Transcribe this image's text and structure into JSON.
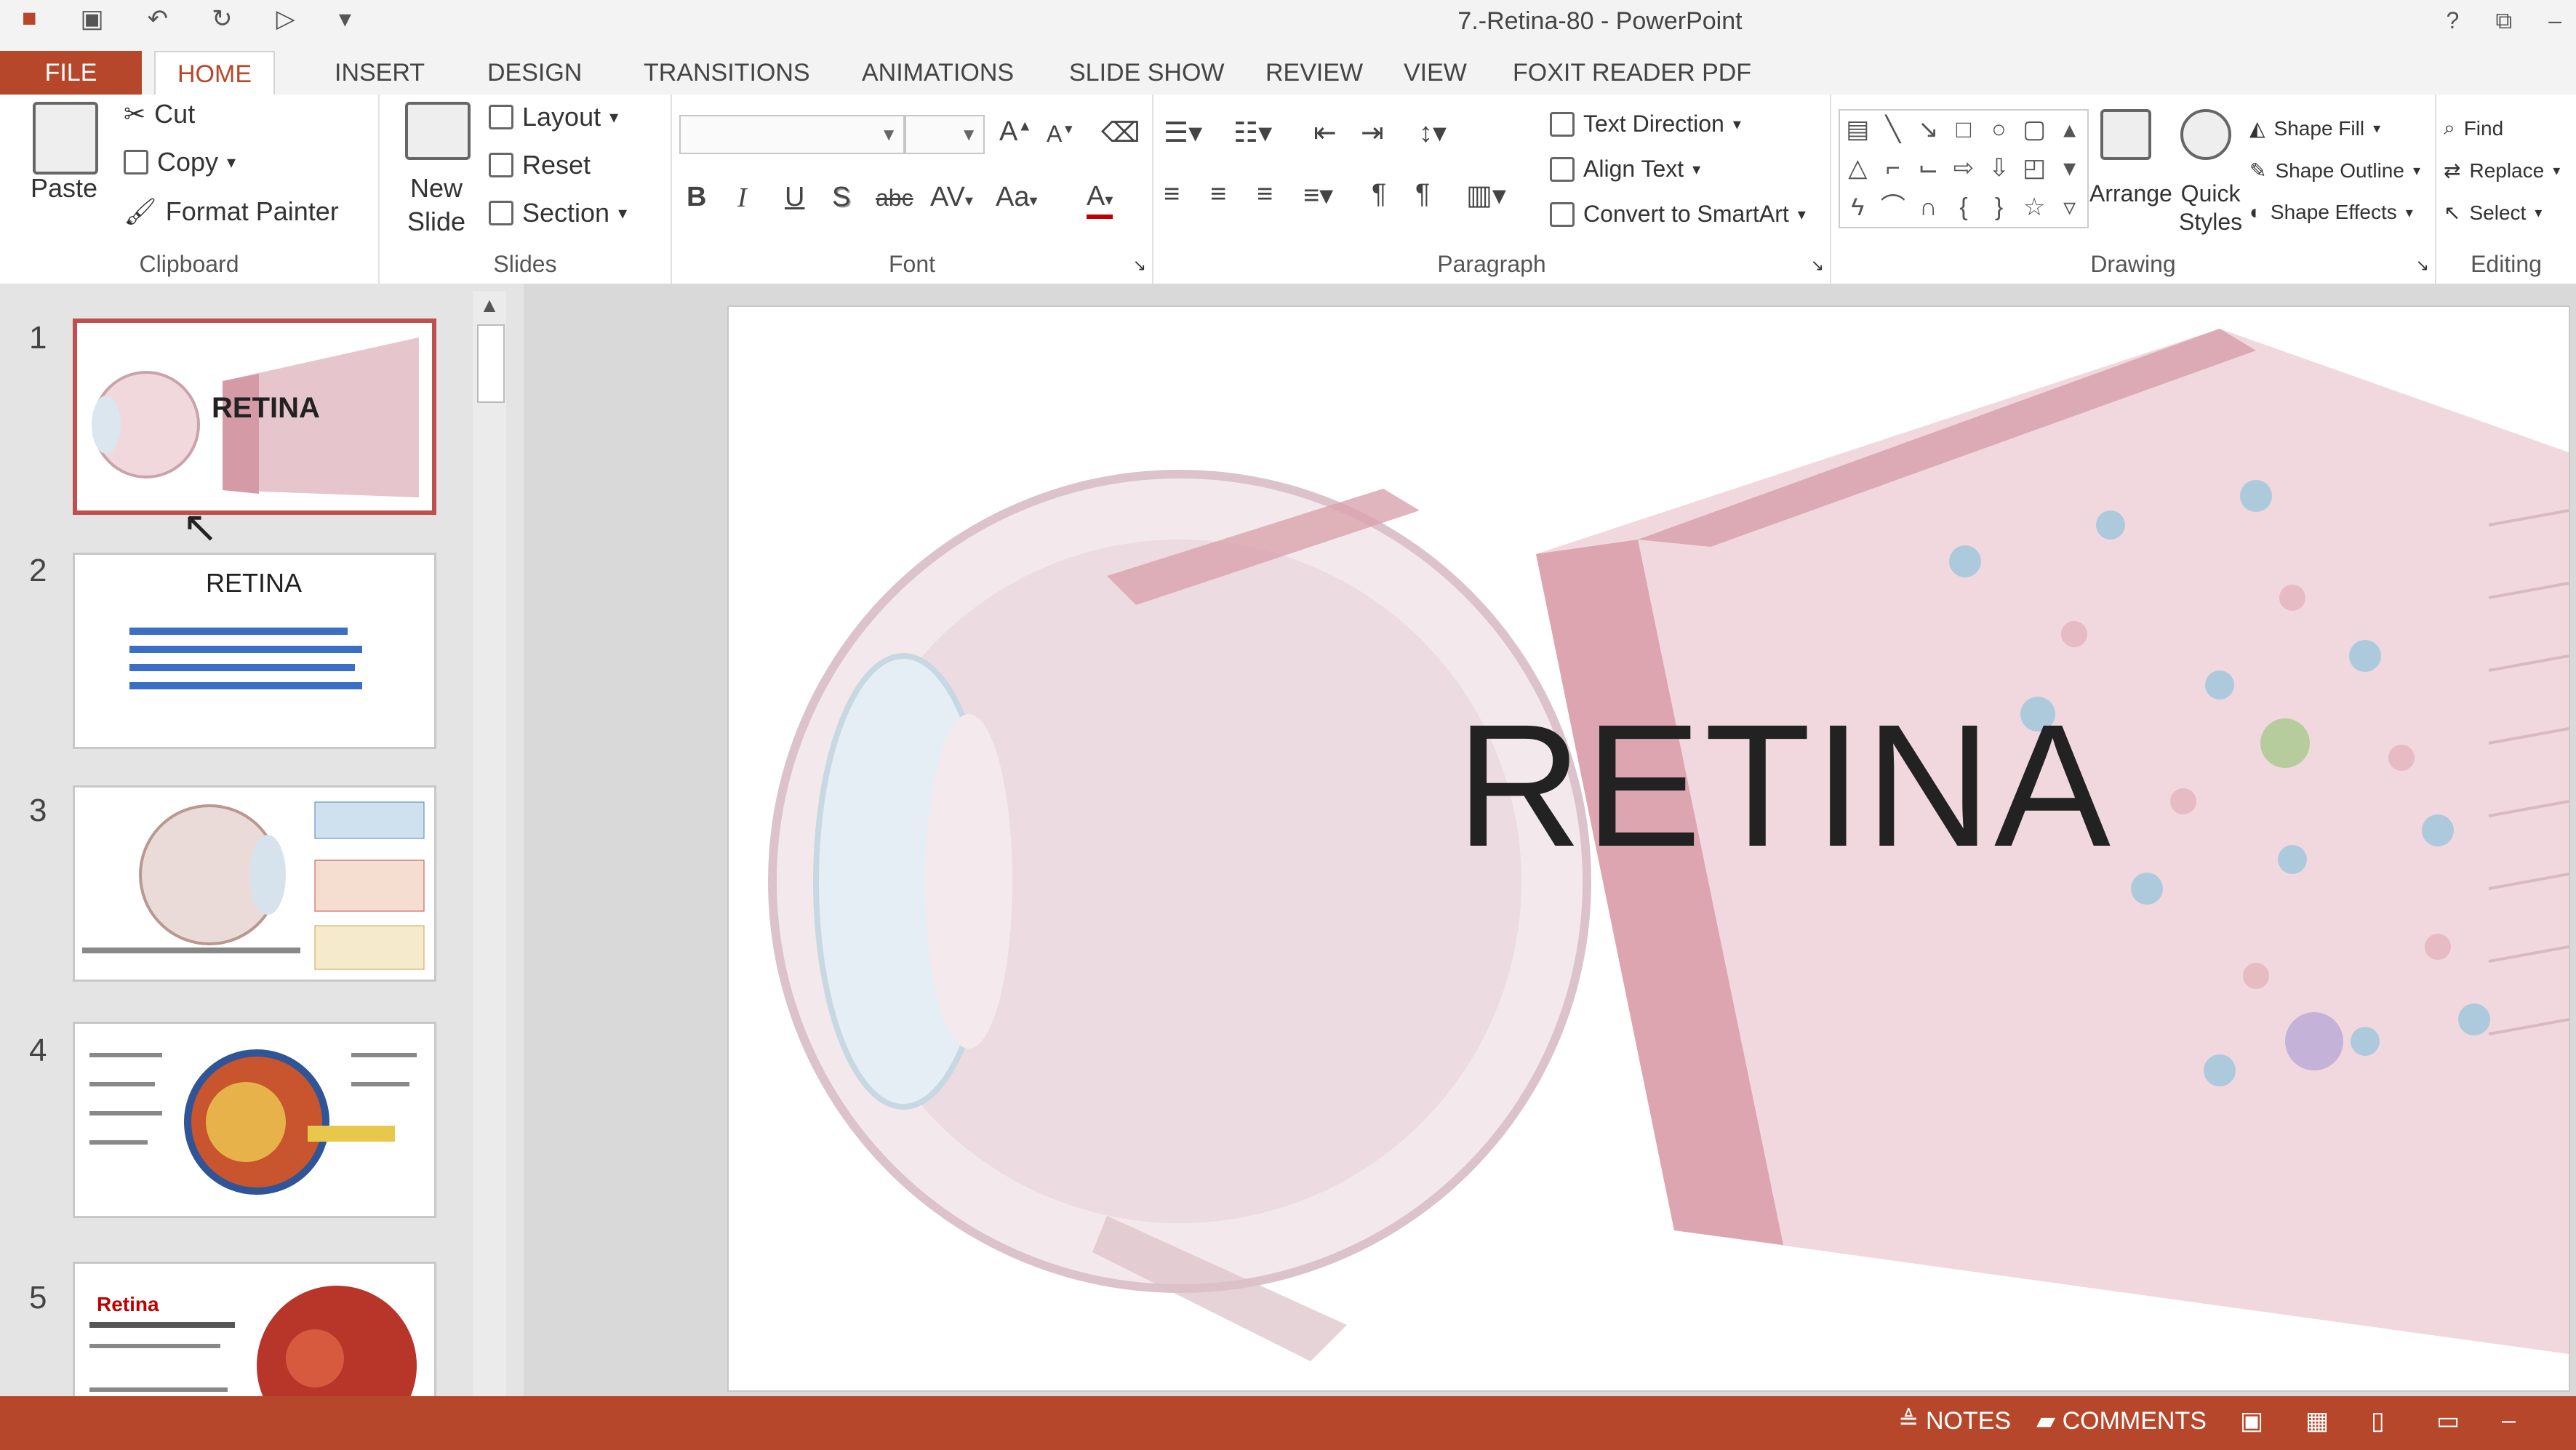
{
  "window": {
    "title": "7.-Retina-80 - PowerPoint",
    "help": "?",
    "restore": "⧉",
    "minimize": "–"
  },
  "tabs": [
    "FILE",
    "HOME",
    "INSERT",
    "DESIGN",
    "TRANSITIONS",
    "ANIMATIONS",
    "SLIDE SHOW",
    "REVIEW",
    "VIEW",
    "FOXIT READER PDF"
  ],
  "clipboard": {
    "label": "Clipboard",
    "paste": "Paste",
    "cut": "Cut",
    "copy": "Copy",
    "format_painter": "Format Painter"
  },
  "slides_group": {
    "label": "Slides",
    "new_slide_1": "New",
    "new_slide_2": "Slide",
    "layout": "Layout",
    "reset": "Reset",
    "section": "Section"
  },
  "font_group": {
    "label": "Font",
    "bold": "B",
    "italic": "I",
    "underline": "U",
    "shadow": "S",
    "strike": "abc",
    "spacing": "AV",
    "case": "Aa",
    "color": "A",
    "grow": "A",
    "shrink": "A"
  },
  "paragraph_group": {
    "label": "Paragraph",
    "text_direction": "Text Direction",
    "align_text": "Align Text",
    "convert_smartart": "Convert to SmartArt"
  },
  "drawing_group": {
    "label": "Drawing",
    "arrange": "Arrange",
    "quick_styles_1": "Quick",
    "quick_styles_2": "Styles",
    "shape_fill": "Shape Fill",
    "shape_outline": "Shape Outline",
    "shape_effects": "Shape Effects"
  },
  "editing_group": {
    "label": "Editing",
    "find": "Find",
    "replace": "Replace",
    "select": "Select"
  },
  "thumbnails": [
    {
      "num": "1",
      "title": "RETINA"
    },
    {
      "num": "2",
      "title": "RETINA"
    },
    {
      "num": "3"
    },
    {
      "num": "4"
    },
    {
      "num": "5",
      "title": "Retina"
    }
  ],
  "slide": {
    "title": "RETINA"
  },
  "status": {
    "notes": "NOTES",
    "comments": "COMMENTS"
  },
  "colors": {
    "accent": "#b7472a",
    "selection": "#c0504d"
  }
}
